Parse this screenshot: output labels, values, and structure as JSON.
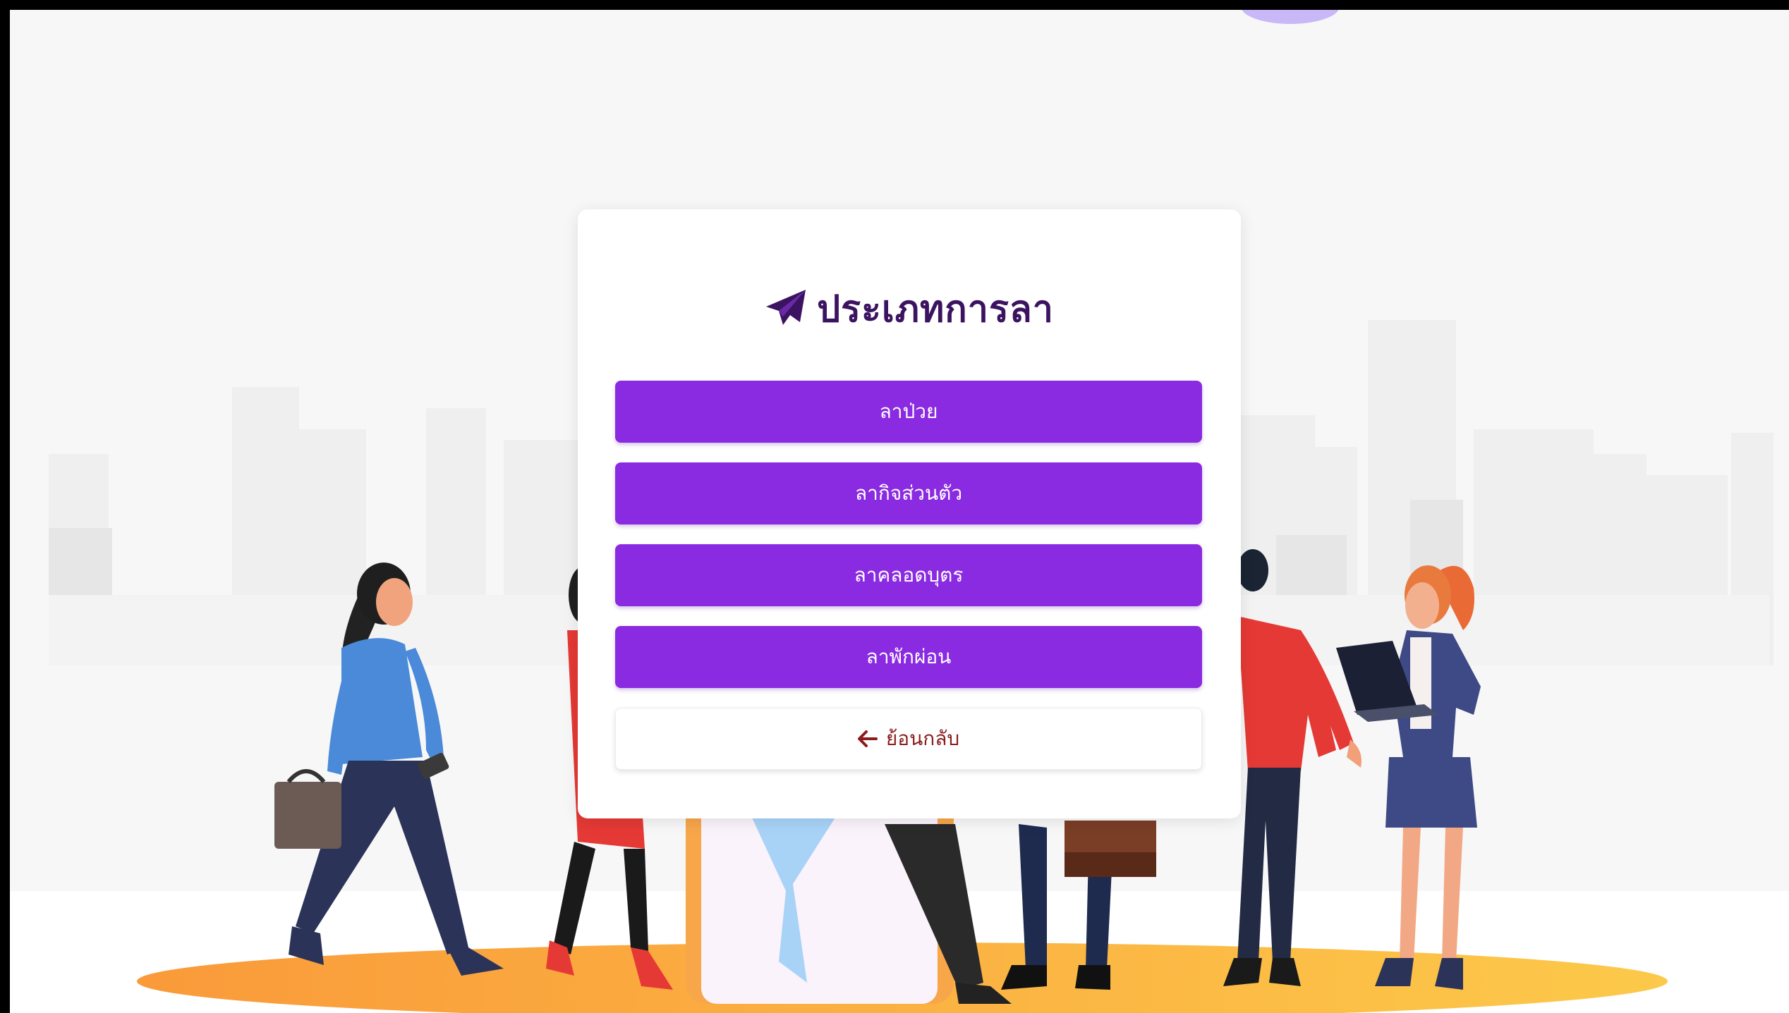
{
  "dialog": {
    "title": "ประเภทการลา",
    "title_icon": "paper-plane-icon"
  },
  "leave_types": [
    {
      "label": "ลาป่วย"
    },
    {
      "label": "ลากิจส่วนตัว"
    },
    {
      "label": "ลาคลอดบุตร"
    },
    {
      "label": "ลาพักผ่อน"
    }
  ],
  "back_button": {
    "label": "ย้อนกลับ",
    "icon": "arrow-left-icon"
  },
  "colors": {
    "accent_purple": "#8a2be2",
    "title_color": "#3c1361",
    "back_text": "#8b1c1c",
    "ground_orange": "#fbb13c"
  }
}
